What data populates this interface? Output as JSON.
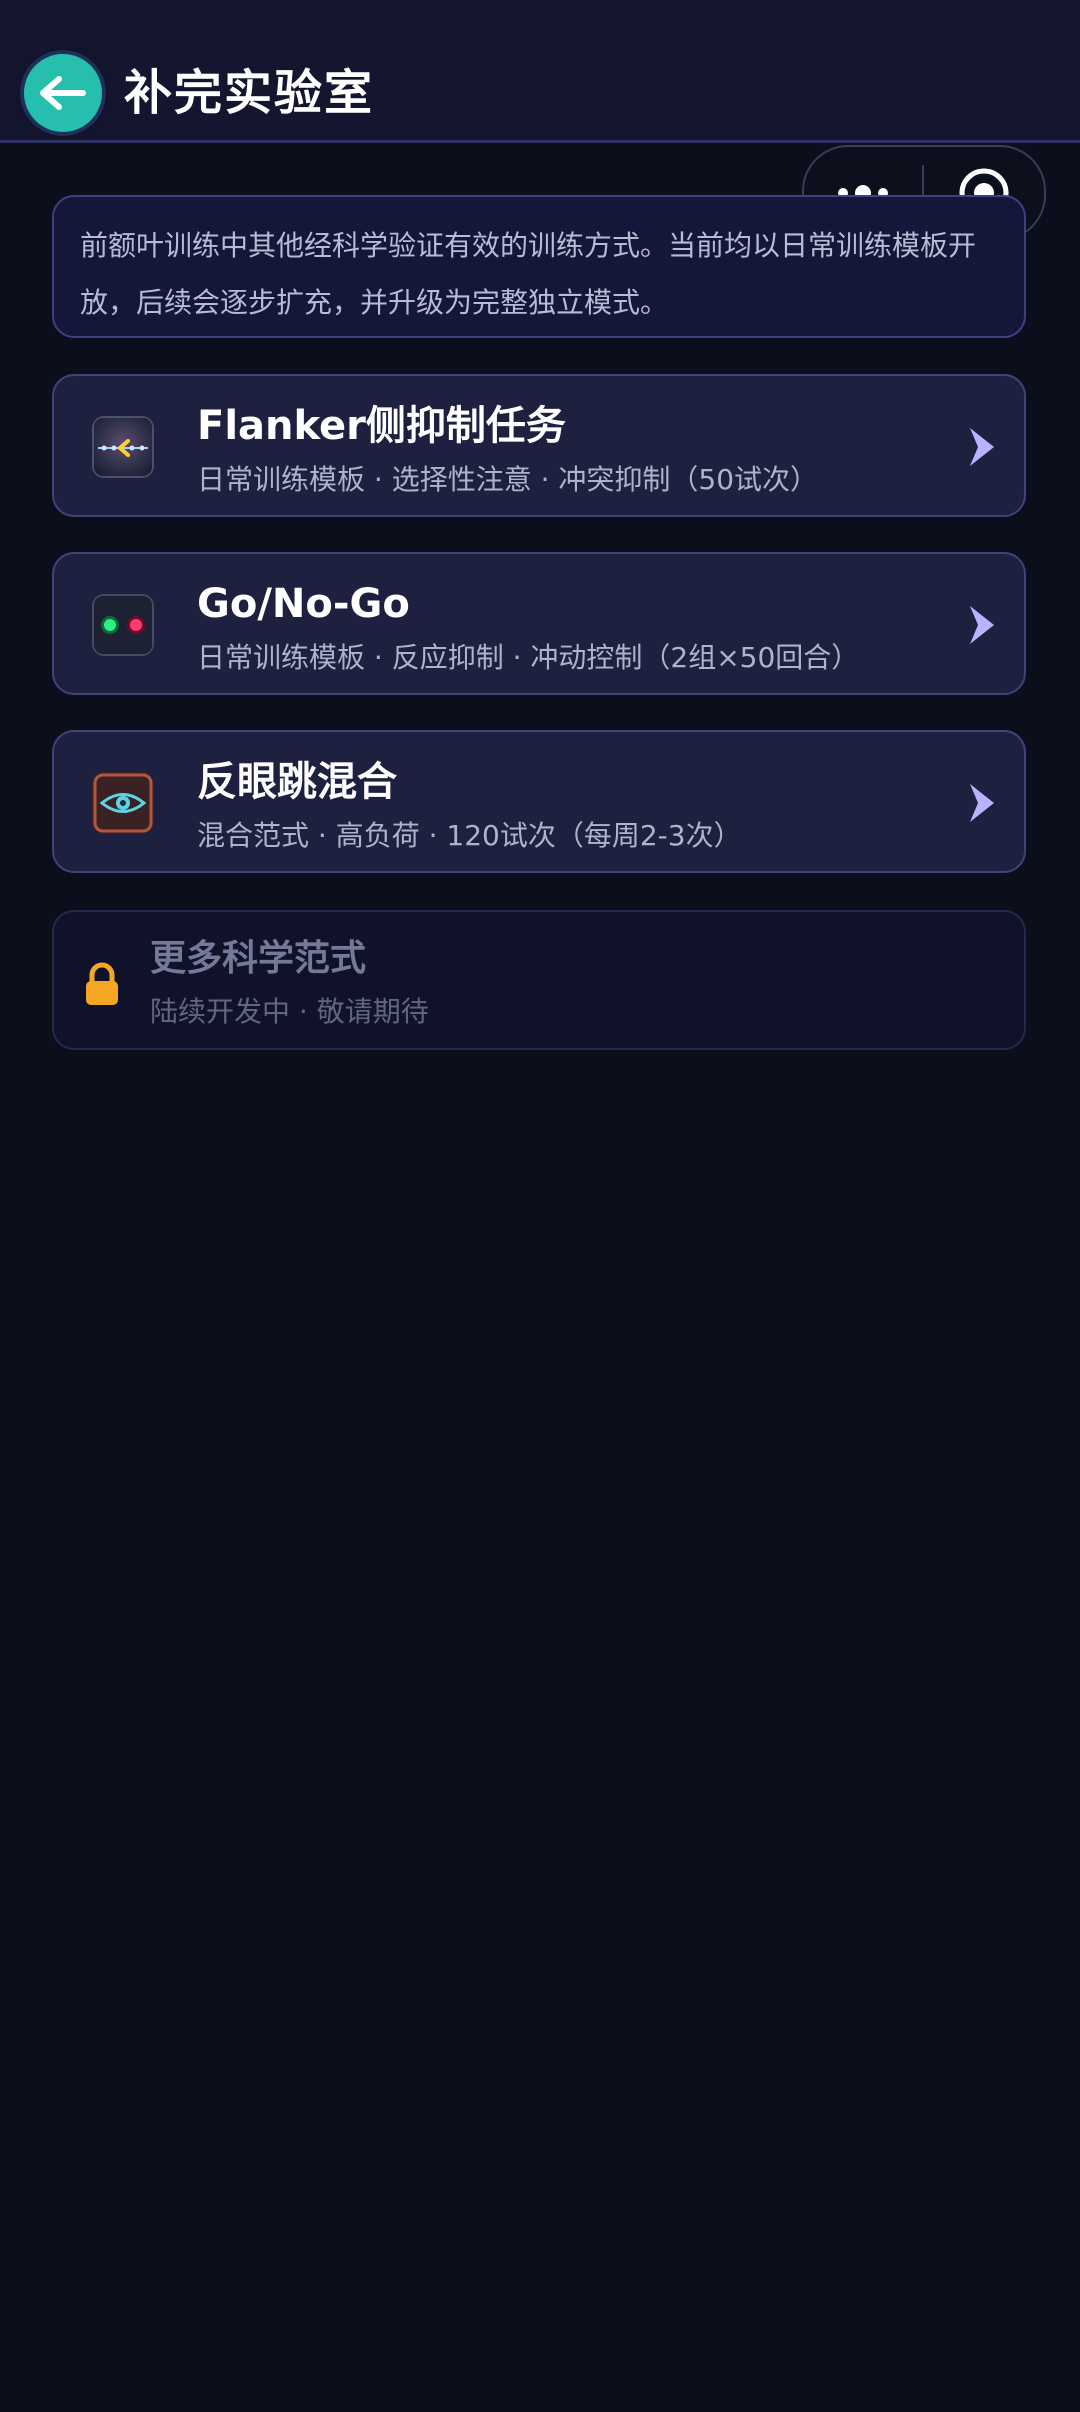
{
  "header": {
    "title": "补完实验室",
    "back_icon": "arrow-left-icon",
    "accent": "#26bfae"
  },
  "capsule": {
    "more_icon": "more-dots-icon",
    "close_icon": "target-circle-icon"
  },
  "intro": {
    "text": "前额叶训练中其他经科学验证有效的训练方式。当前均以日常训练模板开放，后续会逐步扩充，并升级为完整独立模式。"
  },
  "cards": [
    {
      "title": "Flanker侧抑制任务",
      "subtitle": "日常训练模板 · 选择性注意 · 冲突抑制（50试次）",
      "icon": "flanker-arrows-icon"
    },
    {
      "title": "Go/No-Go",
      "subtitle": "日常训练模板 · 反应抑制 · 冲动控制（2组×50回合）",
      "icon": "traffic-lights-icon"
    },
    {
      "title": "反眼跳混合",
      "subtitle": "混合范式 · 高负荷 · 120试次（每周2-3次）",
      "icon": "eye-icon"
    }
  ],
  "locked": {
    "title": "更多科学范式",
    "subtitle": "陆续开发中 · 敬请期待",
    "icon": "lock-icon",
    "lock_color": "#f5a623"
  },
  "colors": {
    "background": "#0b0e1b",
    "card": "#1e2040",
    "card_border": "#3f4379",
    "chevron": "#b9b3ff"
  }
}
